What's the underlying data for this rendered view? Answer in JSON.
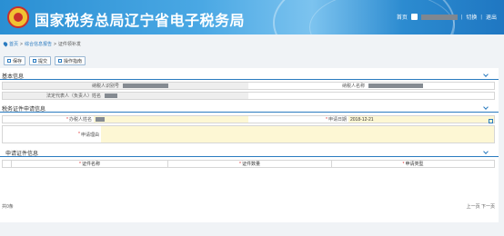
{
  "header": {
    "title": "国家税务总局辽宁省电子税务局",
    "links": {
      "home": "首页",
      "switch": "切换",
      "logout": "退出"
    }
  },
  "breadcrumb": {
    "home": "首页",
    "sep1": ">",
    "level1": "综合信息报告",
    "sep2": ">",
    "current": "证件领补发"
  },
  "toolbar": {
    "save": "保存",
    "submit": "提交",
    "operation": "操作指南"
  },
  "basic_info": {
    "title": "基本信息",
    "taxpayer_id_label": "纳税人识别号",
    "taxpayer_name_label": "纳税人名称",
    "legal_rep_label": "法定代表人（负责人）姓名"
  },
  "apply_info": {
    "title": "税务证件申请信息",
    "handler_label": "办税人姓名",
    "apply_date_label": "申请日期",
    "apply_date_value": "2018-12-21",
    "reason_label": "申请理由"
  },
  "cert_info": {
    "title": "申请证件信息",
    "columns": [
      "证件名称",
      "证件数量",
      "申请类型"
    ]
  },
  "footer": {
    "total": "共0条",
    "prev": "上一页",
    "next": "下一页"
  }
}
